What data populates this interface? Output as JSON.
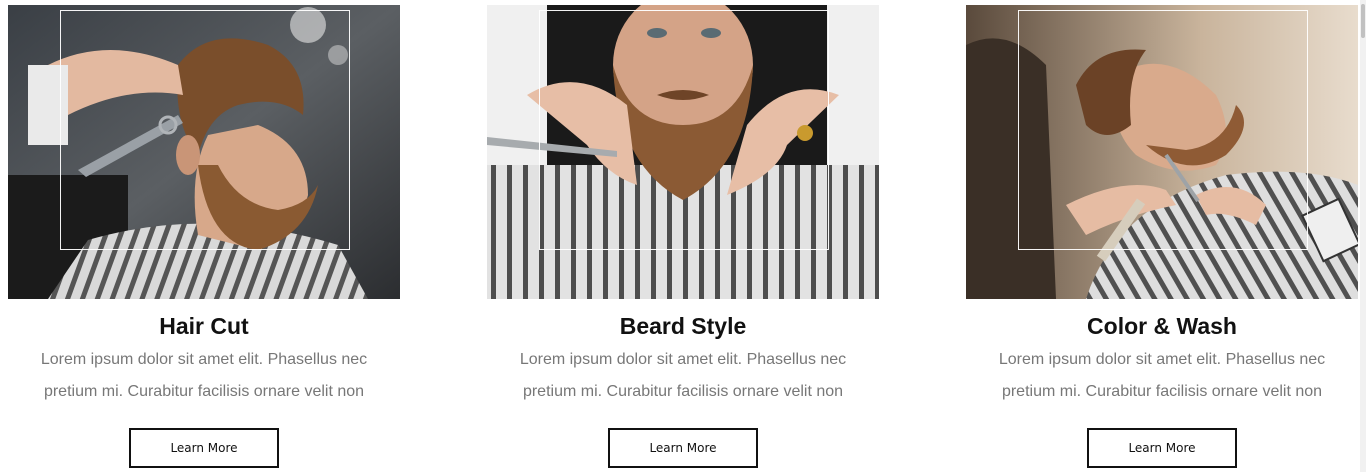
{
  "services": [
    {
      "title": "Hair Cut",
      "description": "Lorem ipsum dolor sit amet elit. Phasellus nec pretium mi. Curabitur facilisis ornare velit non",
      "button_label": "Learn More",
      "image": "barber-cutting-hair-with-scissors-photo"
    },
    {
      "title": "Beard Style",
      "description": "Lorem ipsum dolor sit amet elit. Phasellus nec pretium mi. Curabitur facilisis ornare velit non",
      "button_label": "Learn More",
      "image": "barber-trimming-beard-photo"
    },
    {
      "title": "Color & Wash",
      "description": "Lorem ipsum dolor sit amet elit. Phasellus nec pretium mi. Curabitur facilisis ornare velit non",
      "button_label": "Learn More",
      "image": "barber-shaping-beard-with-comb-photo"
    }
  ],
  "colors": {
    "title": "#111111",
    "description": "#777777",
    "button_border": "#111111",
    "frame": "#ffffff"
  }
}
